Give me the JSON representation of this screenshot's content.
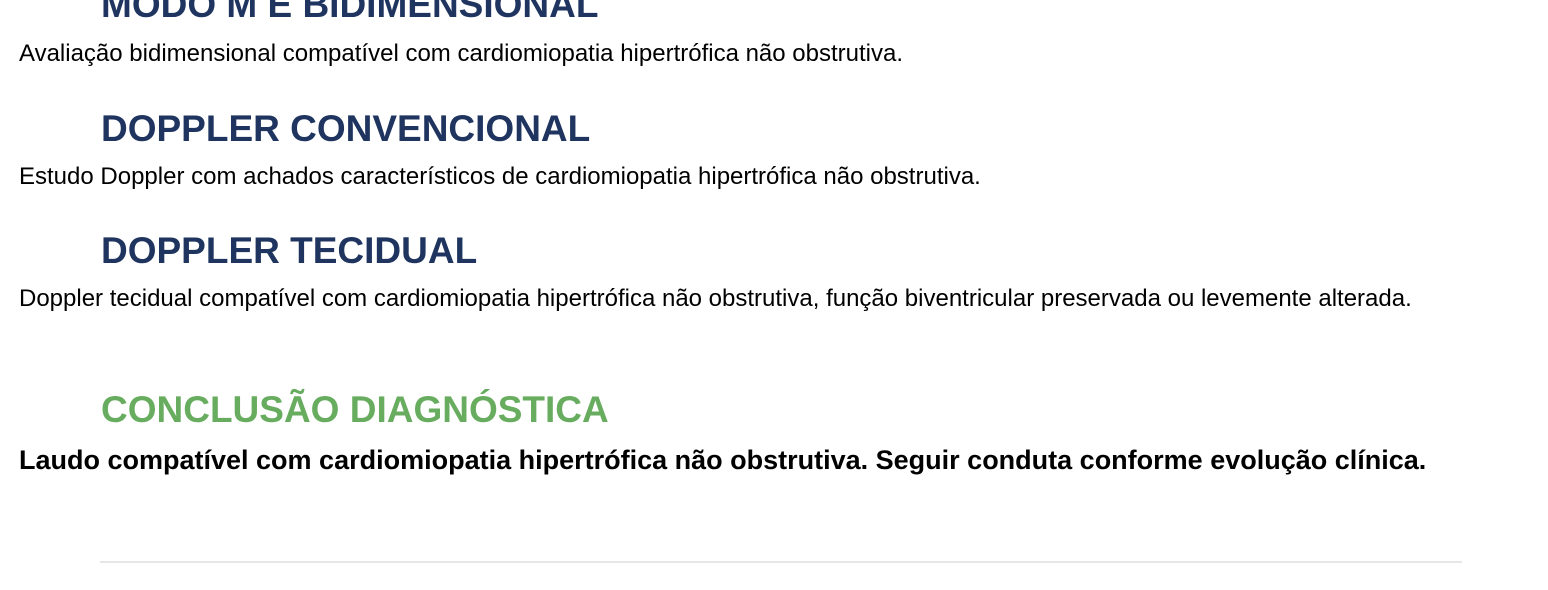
{
  "sections": [
    {
      "heading": "MODO M E BIDIMENSIONAL",
      "text": "Avaliação bidimensional compatível com cardiomiopatia hipertrófica não obstrutiva."
    },
    {
      "heading": "DOPPLER CONVENCIONAL",
      "text": "Estudo Doppler com achados característicos de cardiomiopatia hipertrófica não obstrutiva."
    },
    {
      "heading": "DOPPLER TECIDUAL",
      "text": "Doppler tecidual compatível com cardiomiopatia hipertrófica não obstrutiva, função biventricular preservada ou levemente alterada."
    }
  ],
  "conclusion": {
    "heading": "CONCLUSÃO DIAGNÓSTICA",
    "text": "Laudo compatível com cardiomiopatia hipertrófica não obstrutiva. Seguir conduta conforme evolução clínica."
  },
  "colors": {
    "heading": "#1f3560",
    "conclusion_heading": "#68ad5f",
    "divider": "#e6e6e6"
  }
}
